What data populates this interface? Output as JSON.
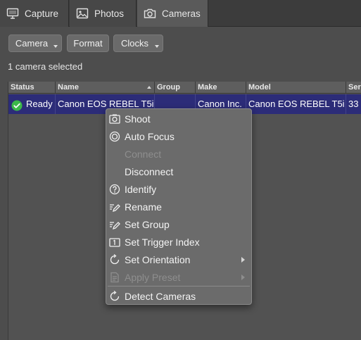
{
  "tabs": [
    {
      "label": "Capture",
      "icon": "monitor-icon"
    },
    {
      "label": "Photos",
      "icon": "photo-icon"
    },
    {
      "label": "Cameras",
      "icon": "camera-icon",
      "active": true
    }
  ],
  "toolbar": {
    "camera_label": "Camera",
    "format_label": "Format",
    "clocks_label": "Clocks"
  },
  "selection_text": "1 camera selected",
  "table": {
    "columns": [
      "Status",
      "Name",
      "Group",
      "Make",
      "Model",
      "Ser"
    ],
    "sort_column": "Name",
    "rows": [
      {
        "status": "Ready",
        "name": "Canon EOS REBEL T5i",
        "group": "",
        "make": "Canon Inc.",
        "model": "Canon EOS REBEL T5i",
        "serial": "33"
      }
    ]
  },
  "context_menu": {
    "items": [
      {
        "label": "Shoot",
        "icon": "camera-icon",
        "enabled": true
      },
      {
        "label": "Auto Focus",
        "icon": "focus-icon",
        "enabled": true
      },
      {
        "label": "Connect",
        "icon": "",
        "enabled": false
      },
      {
        "label": "Disconnect",
        "icon": "",
        "enabled": true
      },
      {
        "label": "Identify",
        "icon": "question-icon",
        "enabled": true
      },
      {
        "label": "Rename",
        "icon": "rename-icon",
        "enabled": true
      },
      {
        "label": "Set Group",
        "icon": "rename-icon",
        "enabled": true
      },
      {
        "label": "Set Trigger Index",
        "icon": "trigger-index-icon",
        "enabled": true
      },
      {
        "label": "Set Orientation",
        "icon": "rotate-icon",
        "enabled": true,
        "submenu": true
      },
      {
        "label": "Apply Preset",
        "icon": "preset-icon",
        "enabled": false,
        "submenu": true
      },
      {
        "label": "Detect Cameras",
        "icon": "refresh-icon",
        "enabled": true
      }
    ]
  },
  "colors": {
    "selection": "#2c2c78",
    "ready_green": "#3cb84a"
  }
}
